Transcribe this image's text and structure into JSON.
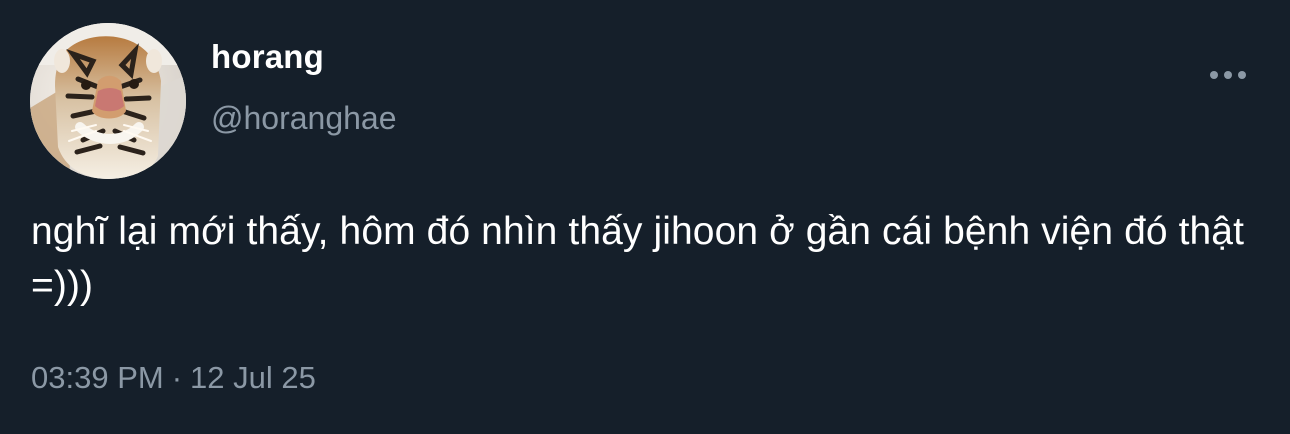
{
  "tweet": {
    "display_name": "horang",
    "handle": "@horanghae",
    "text": "nghĩ lại mới thấy, hôm đó nhìn thấy jihoon ở gần cái bệnh viện đó thật =)))",
    "time": "03:39 PM",
    "separator": "·",
    "date": "12 Jul 25",
    "avatar_icon": "tiger-avatar",
    "more_icon": "more-horizontal-icon"
  },
  "colors": {
    "background": "#15202b",
    "primary_text": "#ffffff",
    "secondary_text": "#8b98a5"
  }
}
